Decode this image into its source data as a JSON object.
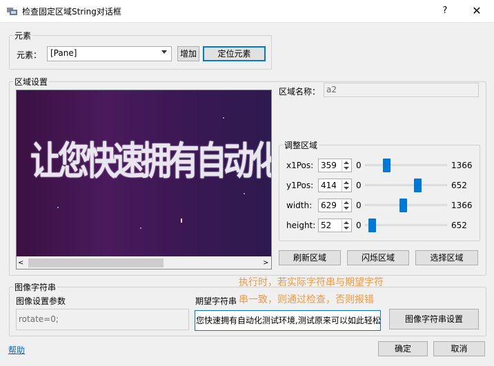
{
  "window": {
    "title": "检查固定区域String对话框",
    "help_glyph": "?",
    "close_glyph": "✕"
  },
  "element_group": {
    "title": "元素",
    "label": "元素：",
    "combo_value": "[Pane]",
    "add_button": "增加",
    "locate_button": "定位元素"
  },
  "region_group": {
    "title": "区域设置",
    "preview_text": "让您快速拥有自动化测试环境，",
    "scroll_left": "<",
    "scroll_right": ">",
    "scroll_position": 0.0,
    "region_name_label": "区域名称：",
    "region_name_value": "a2",
    "adjust_title": "调整区域",
    "rows": [
      {
        "label": "x1Pos:",
        "value": "359",
        "min": "0",
        "max": "1366",
        "level": 0.263
      },
      {
        "label": "y1Pos:",
        "value": "414",
        "min": "0",
        "max": "652",
        "level": 0.635
      },
      {
        "label": "width:",
        "value": "629",
        "min": "0",
        "max": "1366",
        "level": 0.46
      },
      {
        "label": "height:",
        "value": "52",
        "min": "0",
        "max": "652",
        "level": 0.08
      }
    ],
    "refresh_button": "刷新区域",
    "flash_button": "闪烁区域",
    "select_button": "选择区域"
  },
  "image_string_group": {
    "title": "图像字符串",
    "params_label": "图像设置参数",
    "params_value": "rotate=0;",
    "expected_label": "期望字符串",
    "expected_value": "您快速拥有自动化测试环境,测试原来可以如此轻松",
    "setup_button": "图像字符串设置",
    "note_line1": "执行时，若实际字符串与期望字符",
    "note_line2": "串一致，则通过检查，否则报错"
  },
  "footer": {
    "help_link": "帮助",
    "ok_button": "确定",
    "cancel_button": "取消"
  },
  "colors": {
    "accent": "#0078d7",
    "note": "#f09a3e",
    "link": "#0066cc"
  }
}
